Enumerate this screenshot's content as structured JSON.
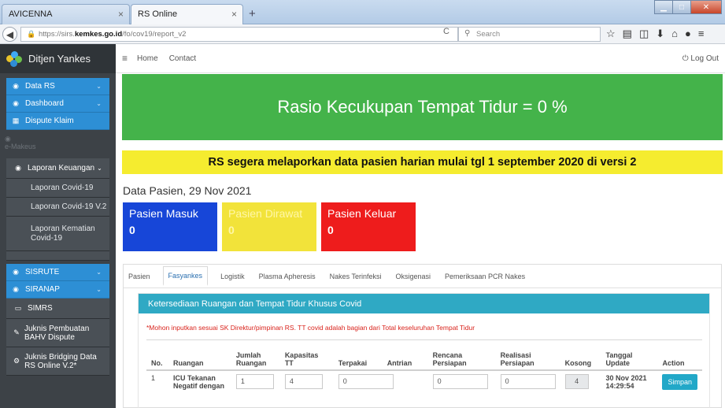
{
  "browser": {
    "tabs": [
      {
        "title": "AVICENNA",
        "close": "×"
      },
      {
        "title": "RS Online",
        "close": "×"
      }
    ],
    "new_tab": "+",
    "url_prefix": "https://sirs.",
    "url_domain": "kemkes.go.id",
    "url_path": "/fo/cov19/report_v2",
    "search_placeholder": "Search"
  },
  "sidebar": {
    "brand": "Ditjen Yankes",
    "items": [
      {
        "label": "Data RS",
        "icon": "dashboard-icon",
        "has_chevron": true
      },
      {
        "label": "Dashboard",
        "icon": "dashboard-icon",
        "has_chevron": true
      },
      {
        "label": "Dispute Klaim",
        "icon": "calendar-icon",
        "has_chevron": false
      }
    ],
    "faded_text": "e-Makeus",
    "laporan_keuangan": "Laporan Keuangan",
    "sub_items": [
      "Laporan Covid-19",
      "Laporan Covid-19 V.2",
      "Laporan Kematian Covid-19"
    ],
    "items2": [
      {
        "label": "SISRUTE",
        "has_chevron": true
      },
      {
        "label": "SIRANAP",
        "has_chevron": true
      }
    ],
    "simrs": "SIMRS",
    "juknis_bahv": "Juknis Pembuatan BAHV Dispute",
    "juknis_bridging": "Juknis Bridging Data RS Online V.2*"
  },
  "topnav": {
    "home": "Home",
    "contact": "Contact",
    "logout": "Log Out"
  },
  "banner_green": "Rasio Kecukupan Tempat Tidur = 0 %",
  "banner_yellow": "RS segera melaporkan data pasien harian mulai tgl 1 september 2020 di versi 2",
  "section_title": "Data Pasien, 29 Nov 2021",
  "stats": [
    {
      "label": "Pasien Masuk",
      "value": "0"
    },
    {
      "label": "Pasien Dirawat",
      "value": "0"
    },
    {
      "label": "Pasien Keluar",
      "value": "0"
    }
  ],
  "tabs": [
    "Pasien",
    "Fasyankes",
    "Logistik",
    "Plasma Apheresis",
    "Nakes Terinfeksi",
    "Oksigenasi",
    "Pemeriksaan PCR Nakes"
  ],
  "active_tab": "Fasyankes",
  "card_title": "Ketersediaan Ruangan dan Tempat Tidur Khusus Covid",
  "note": "*Mohon inputkan sesuai SK Direktur/pimpinan RS. TT covid adalah bagian dari Total keseluruhan Tempat Tidur",
  "table": {
    "headers": [
      "No.",
      "Ruangan",
      "Jumlah Ruangan",
      "Kapasitas TT",
      "Terpakai",
      "Antrian",
      "Rencana Persiapan",
      "Realisasi Persiapan",
      "Kosong",
      "Tanggal Update",
      "Action"
    ],
    "rows": [
      {
        "no": "1",
        "ruangan": "ICU Tekanan Negatif dengan",
        "jumlah_ruangan": "1",
        "kapasitas_tt": "4",
        "terpakai": "0",
        "antrian": "",
        "rencana_persiapan": "0",
        "realisasi_persiapan": "0",
        "kosong": "4",
        "tanggal_update": "30 Nov 2021 14:29:54",
        "action": "Simpan"
      }
    ]
  },
  "colors": {
    "green": "#44b34a",
    "yellow": "#f5ec2f",
    "blue_stat": "#1746d8",
    "red_stat": "#ee1c1c",
    "sidebar_blue": "#2d8fd5",
    "card_head": "#2fa9c4"
  }
}
